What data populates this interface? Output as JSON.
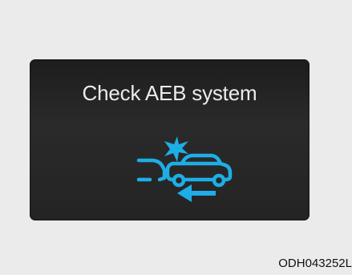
{
  "display": {
    "message": "Check AEB system",
    "icon": "aeb-collision-warning-icon"
  },
  "caption": "ODH043252L",
  "colors": {
    "background": "#ebebeb",
    "display": "#232323",
    "text": "#ececec",
    "icon": "#1eaee6"
  }
}
